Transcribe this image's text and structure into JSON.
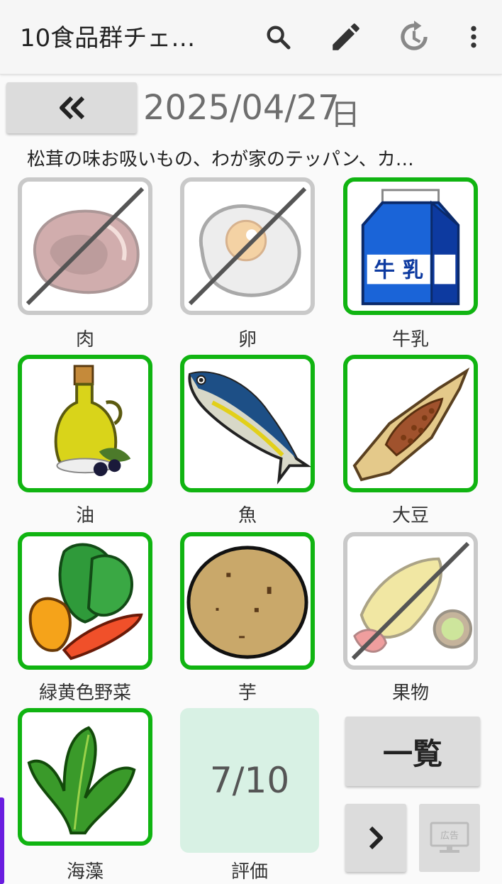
{
  "app": {
    "title": "10食品群チェ…",
    "icons": [
      "search-icon",
      "edit-pencil-icon",
      "history-icon",
      "more-vert-icon"
    ]
  },
  "nav": {
    "back_icon": "double-chevron-left-icon",
    "date": "2025/04/27",
    "date_suffix": "日"
  },
  "meal_summary": "松茸の味お吸いもの、わが家のテッパン、カ…",
  "food_groups": [
    {
      "label": "肉",
      "checked": false,
      "icon": "meat-icon"
    },
    {
      "label": "卵",
      "checked": false,
      "icon": "egg-icon"
    },
    {
      "label": "牛乳",
      "checked": true,
      "icon": "milk-carton-icon",
      "carton_text": "牛 乳"
    },
    {
      "label": "油",
      "checked": true,
      "icon": "olive-oil-icon"
    },
    {
      "label": "魚",
      "checked": true,
      "icon": "fish-icon"
    },
    {
      "label": "大豆",
      "checked": true,
      "icon": "natto-icon"
    },
    {
      "label": "緑黄色野菜",
      "checked": true,
      "icon": "vegetables-icon"
    },
    {
      "label": "芋",
      "checked": true,
      "icon": "potato-icon"
    },
    {
      "label": "果物",
      "checked": false,
      "icon": "fruits-icon"
    },
    {
      "label": "海藻",
      "checked": true,
      "icon": "seaweed-icon"
    }
  ],
  "evaluation": {
    "score": "7/10",
    "label": "評価"
  },
  "buttons": {
    "list_label": "一覧",
    "next_icon": "chevron-right-icon",
    "ad_label": "広告"
  },
  "colors": {
    "checked_border": "#10b411",
    "unchecked_border": "#c9c9c9",
    "eval_bg": "#d8f1e4",
    "accent": "#6a1de0"
  }
}
